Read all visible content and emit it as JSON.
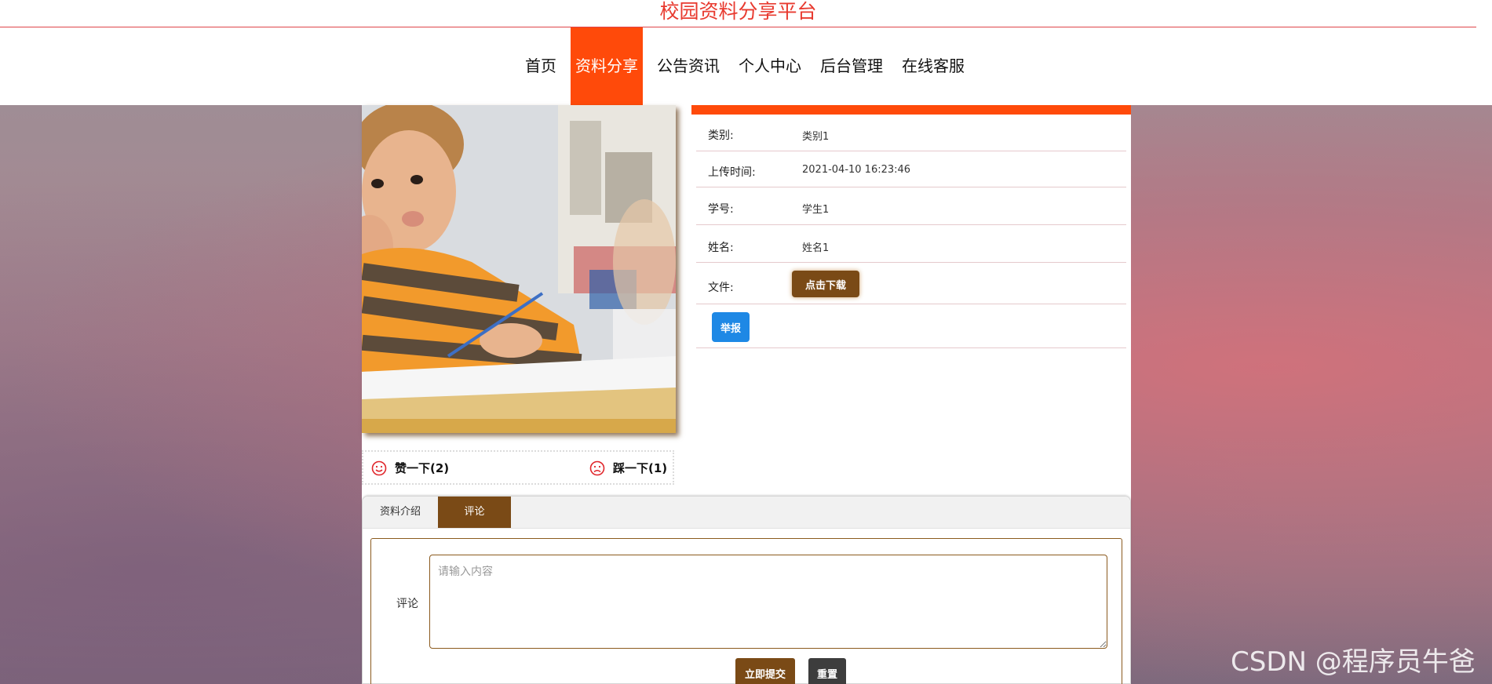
{
  "site": {
    "title": "校园资料分享平台"
  },
  "nav": {
    "items": [
      {
        "label": "首页"
      },
      {
        "label": "资料分享"
      },
      {
        "label": "公告资讯"
      },
      {
        "label": "个人中心"
      },
      {
        "label": "后台管理"
      },
      {
        "label": "在线客服"
      }
    ],
    "active_index": 1
  },
  "detail": {
    "rows": [
      {
        "label": "类别:",
        "value": "类别1"
      },
      {
        "label": "上传时间:",
        "value": "2021-04-10 16:23:46"
      },
      {
        "label": "学号:",
        "value": "学生1"
      },
      {
        "label": "姓名:",
        "value": "姓名1"
      },
      {
        "label": "文件:"
      }
    ],
    "download_label": "点击下载",
    "report_label": "举报"
  },
  "votes": {
    "like_label": "赞一下(2)",
    "dislike_label": "踩一下(1)"
  },
  "tabs": {
    "items": [
      {
        "label": "资料介绍"
      },
      {
        "label": "评论"
      }
    ],
    "active_index": 1
  },
  "comment": {
    "label": "评论",
    "placeholder": "请输入内容",
    "submit_label": "立即提交",
    "reset_label": "重置"
  },
  "watermark": {
    "text": "CSDN @程序员牛爸"
  },
  "colors": {
    "accent": "#ff4a0a",
    "brown": "#7a4a16",
    "title_red": "#e83a2f",
    "report_blue": "#1e88e5"
  }
}
